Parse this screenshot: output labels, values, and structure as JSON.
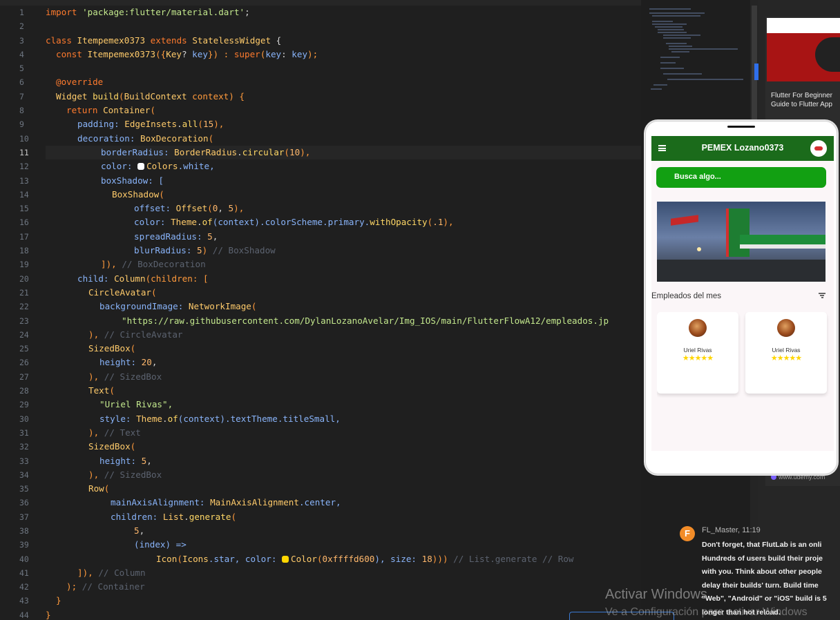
{
  "editor": {
    "active_line": 11,
    "lines": [
      "1",
      "2",
      "3",
      "4",
      "5",
      "6",
      "7",
      "8",
      "9",
      "10",
      "11",
      "12",
      "13",
      "14",
      "15",
      "16",
      "17",
      "18",
      "19",
      "20",
      "21",
      "22",
      "23",
      "24",
      "25",
      "26",
      "27",
      "28",
      "29",
      "30",
      "31",
      "32",
      "33",
      "34",
      "35",
      "36",
      "37",
      "38",
      "39",
      "40",
      "41",
      "42",
      "43",
      "44"
    ],
    "code": {
      "l1_a": "import ",
      "l1_b": "'package:flutter/material.dart'",
      "l1_c": ";",
      "l3_a": "class ",
      "l3_b": "Itempemex0373",
      "l3_c": " extends ",
      "l3_d": "StatelessWidget",
      "l3_e": " {",
      "l4_a": "const ",
      "l4_b": "Itempemex0373",
      "l4_c": "({",
      "l4_d": "Key",
      "l4_e": "? ",
      "l4_f": "key",
      "l4_g": "}) : ",
      "l4_h": "super",
      "l4_i": "(",
      "l4_j": "key",
      "l4_k": ": ",
      "l4_l": "key",
      "l4_m": ");",
      "l6": "@override",
      "l7_a": "Widget ",
      "l7_b": "build",
      "l7_c": "(",
      "l7_d": "BuildContext",
      "l7_e": " context) {",
      "l8_a": "return ",
      "l8_b": "Container",
      "l8_c": "(",
      "l9_a": "padding: ",
      "l9_b": "EdgeInsets",
      "l9_c": ".",
      "l9_d": "all",
      "l9_e": "(",
      "l9_f": "15",
      "l9_g": "),",
      "l10_a": "decoration: ",
      "l10_b": "BoxDecoration",
      "l10_c": "(",
      "l11_a": "borderRadius: ",
      "l11_b": "BorderRadius",
      "l11_c": ".",
      "l11_d": "circular",
      "l11_e": "(",
      "l11_f": "10",
      "l11_g": "),",
      "l12_a": "color: ",
      "l12_b": "Colors",
      "l12_c": ".white,",
      "l13_a": "boxShadow: [",
      "l14_a": "BoxShadow",
      "l14_b": "(",
      "l15_a": "offset: ",
      "l15_b": "Offset",
      "l15_c": "(",
      "l15_d": "0",
      "l15_e": ", ",
      "l15_f": "5",
      "l15_g": "),",
      "l16_a": "color: ",
      "l16_b": "Theme",
      "l16_c": ".",
      "l16_d": "of",
      "l16_e": "(context).colorScheme.primary.",
      "l16_f": "withOpacity",
      "l16_g": "(",
      "l16_h": ".1",
      "l16_i": "),",
      "l17_a": "spreadRadius: ",
      "l17_b": "5",
      "l17_c": ",",
      "l18_a": "blurRadius: ",
      "l18_b": "5",
      "l18_c": ") ",
      "l18_d": "// BoxShadow",
      "l19_a": "]), ",
      "l19_b": "// BoxDecoration",
      "l20_a": "child: ",
      "l20_b": "Column",
      "l20_c": "(children: [",
      "l21_a": "CircleAvatar",
      "l21_b": "(",
      "l22_a": "backgroundImage: ",
      "l22_b": "NetworkImage",
      "l22_c": "(",
      "l23": "\"https://raw.githubusercontent.com/DylanLozanoAvelar/Img_IOS/main/FlutterFlowA12/empleados.jp",
      "l24_a": "), ",
      "l24_b": "// CircleAvatar",
      "l25_a": "SizedBox",
      "l25_b": "(",
      "l26_a": "height: ",
      "l26_b": "20",
      "l26_c": ",",
      "l27_a": "), ",
      "l27_b": "// SizedBox",
      "l28_a": "Text",
      "l28_b": "(",
      "l29": "\"Uriel Rivas\",",
      "l30_a": "style: ",
      "l30_b": "Theme",
      "l30_c": ".",
      "l30_d": "of",
      "l30_e": "(context).textTheme.titleSmall,",
      "l31_a": "), ",
      "l31_b": "// Text",
      "l32_a": "SizedBox",
      "l32_b": "(",
      "l33_a": "height: ",
      "l33_b": "5",
      "l33_c": ",",
      "l34_a": "), ",
      "l34_b": "// SizedBox",
      "l35_a": "Row",
      "l35_b": "(",
      "l36_a": "mainAxisAlignment: ",
      "l36_b": "MainAxisAlignment",
      "l36_c": ".center,",
      "l37_a": "children: ",
      "l37_b": "List",
      "l37_c": ".",
      "l37_d": "generate",
      "l37_e": "(",
      "l38_a": "5",
      "l38_b": ",",
      "l39_a": "(index) =>",
      "l40_a": "Icon",
      "l40_b": "(",
      "l40_c": "Icons",
      "l40_d": ".star, color: ",
      "l40_e": "Color",
      "l40_f": "(",
      "l40_g": "0xffffd600",
      "l40_h": "), size: ",
      "l40_i": "18",
      "l40_j": "))) ",
      "l40_k": "// List.generate // Row",
      "l41_a": "]), ",
      "l41_b": "// Column",
      "l42_a": "); ",
      "l42_b": "// Container",
      "l43": "}",
      "l44": "}"
    },
    "colors": {
      "background": "#1f1f1f",
      "keyword": "#ff7b2e",
      "string": "#c3e88d",
      "type": "#ffcb6b",
      "comment": "#5c6370",
      "white_swatch": "#ffffff",
      "yellow_swatch": "#ffd600"
    }
  },
  "right_panel": {
    "ad_title_line1": "Flutter For Beginner",
    "ad_title_line2": "Guide to Flutter App",
    "ad_link": "www.udemy.com"
  },
  "phone": {
    "app_title": "PEMEX Lozano0373",
    "search_label": "Busca algo...",
    "section_title": "Empleados del mes",
    "employees": [
      {
        "name": "Uriel Rivas",
        "stars": "★★★★★"
      },
      {
        "name": "Uriel Rivas",
        "stars": "★★★★★"
      }
    ],
    "colors": {
      "appbar": "#1b6b1b",
      "searchbar": "#12a012",
      "star": "#ffd600"
    }
  },
  "chat": {
    "avatar_letter": "F",
    "author": "FL_Master, 11:19",
    "lines": [
      "Don't forget, that FlutLab is an onli",
      "Hundreds of users build their proje",
      "with you. Think about other people",
      "delay their builds' turn. Build time",
      "\"Web\", \"Android\" or \"iOS\" build is 5",
      "longer than hot reload."
    ]
  },
  "os": {
    "watermark_line1": "Activar Windows",
    "watermark_line2": "Ve a Configuración para activar Windows"
  }
}
